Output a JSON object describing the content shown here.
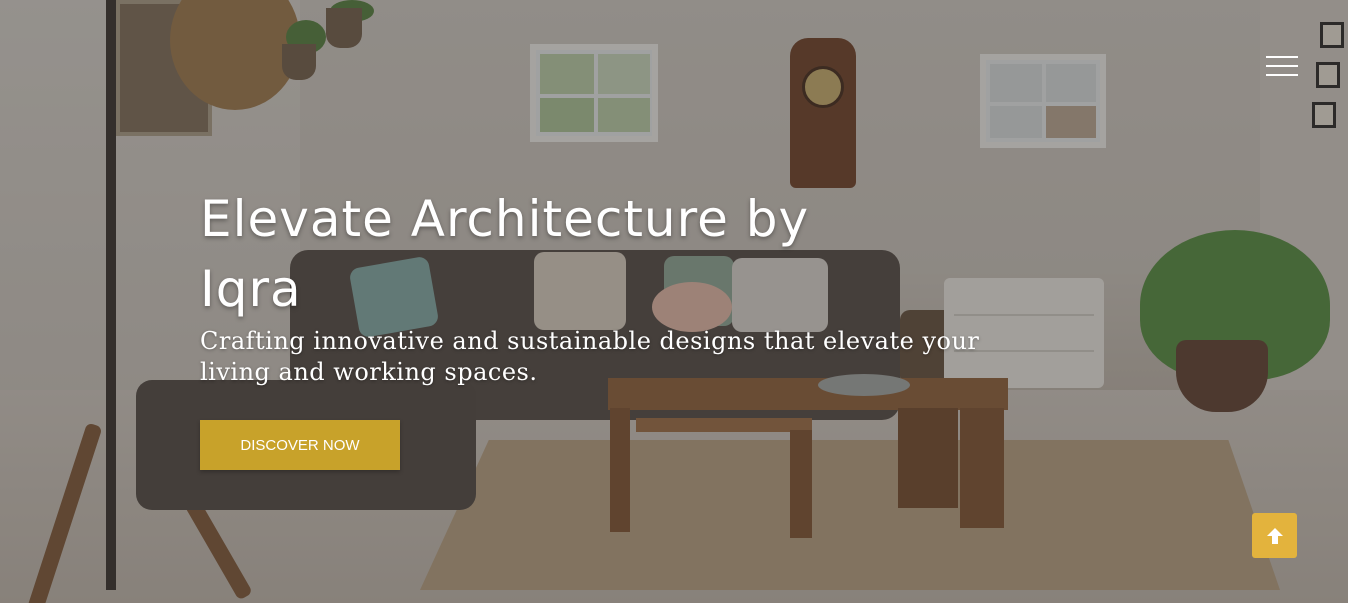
{
  "hero": {
    "headline": "Elevate Architecture by Iqra",
    "subtitle": "Crafting innovative and sustainable designs that elevate your living and working spaces.",
    "cta_label": "DISCOVER NOW"
  },
  "nav": {
    "menu_icon": "hamburger-menu-icon"
  },
  "scroll_top": {
    "icon": "arrow-up-icon"
  },
  "colors": {
    "accent": "#c8a22a",
    "scroll_button": "#e3b33d",
    "text": "#ffffff"
  }
}
